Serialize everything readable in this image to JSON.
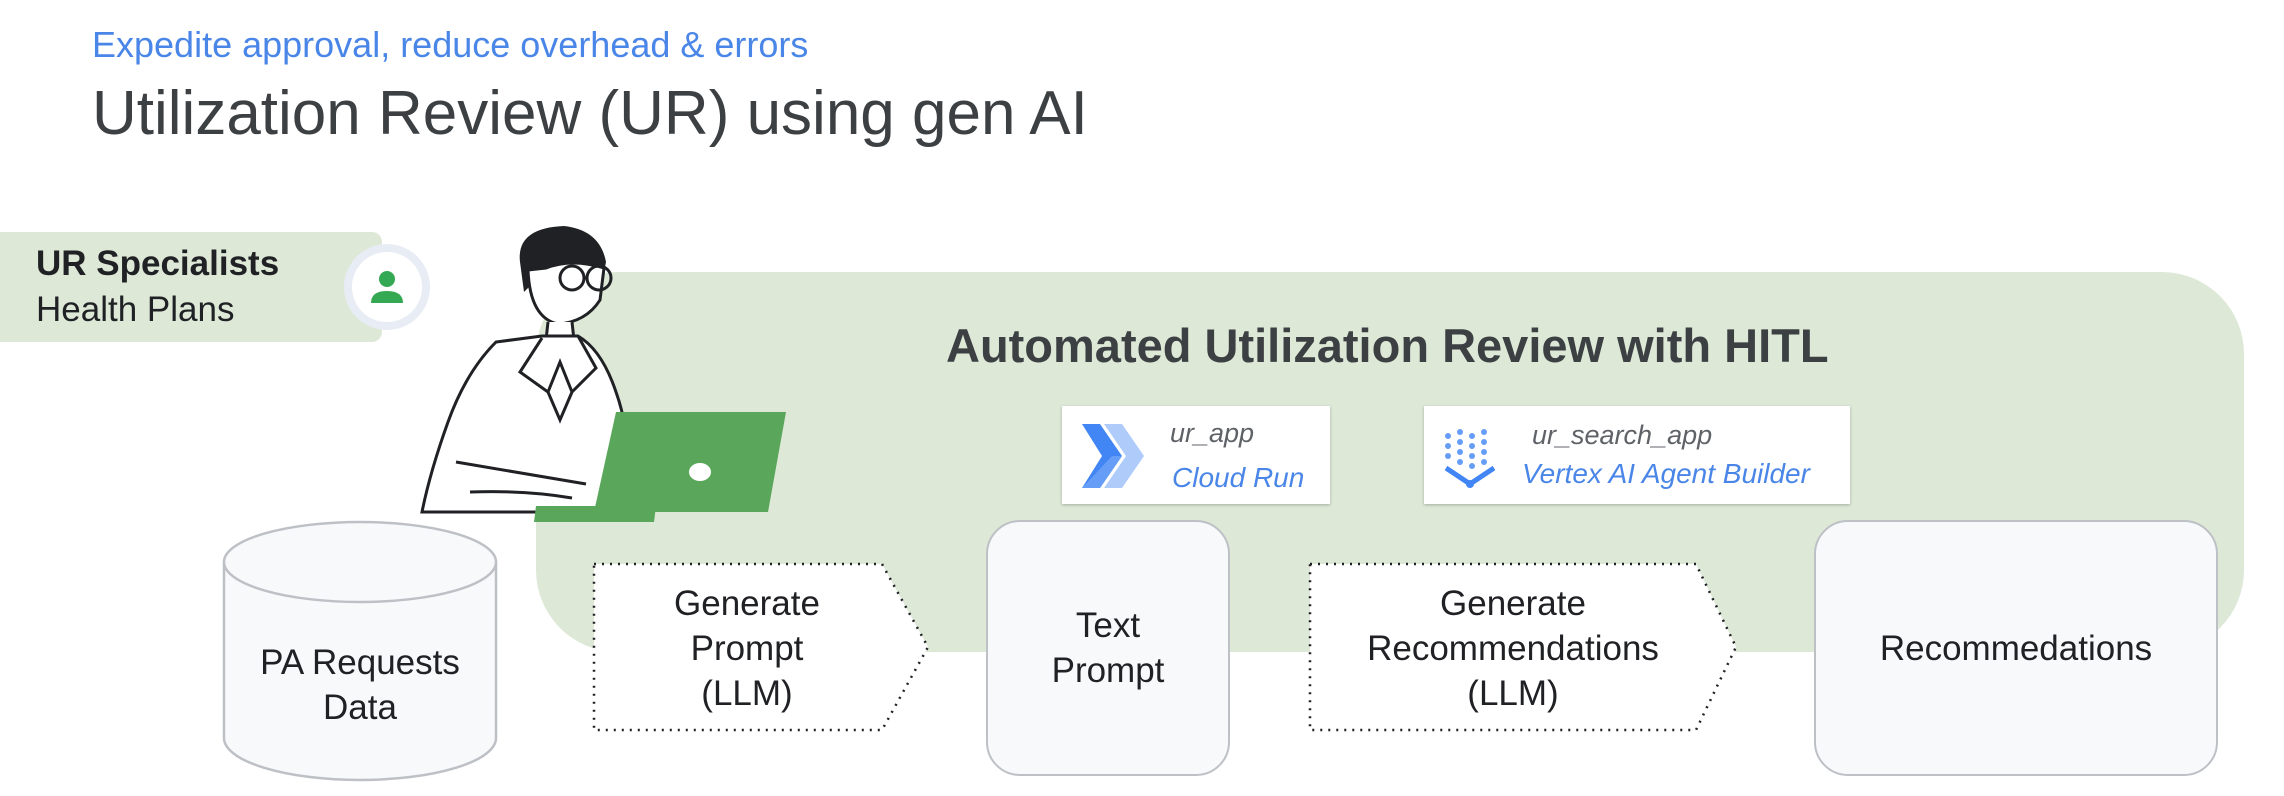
{
  "header": {
    "subtitle": "Expedite approval, reduce overhead & errors",
    "title": "Utilization Review (UR) using gen AI"
  },
  "specialist": {
    "line1": "UR Specialists",
    "line2": "Health Plans"
  },
  "panel": {
    "title": "Automated Utilization Review with HITL"
  },
  "services": [
    {
      "name": "ur_app",
      "product": "Cloud Run",
      "icon": "cloud-run-icon"
    },
    {
      "name": "ur_search_app",
      "product": "Vertex AI Agent Builder",
      "icon": "vertex-ai-agent-builder-icon"
    }
  ],
  "flow": {
    "data_store": {
      "line1": "PA Requests",
      "line2": "Data"
    },
    "step1": {
      "line1": "Generate",
      "line2": "Prompt",
      "line3": "(LLM)"
    },
    "text_prompt": {
      "line1": "Text",
      "line2": "Prompt"
    },
    "step2": {
      "line1": "Generate",
      "line2": "Recommendations",
      "line3": "(LLM)"
    },
    "result": {
      "label": "Recommedations"
    }
  },
  "colors": {
    "accent_blue": "#4a86e8",
    "panel_green": "#dde8d7",
    "laptop_green": "#5aa65a",
    "box_fill": "#f8f9fa",
    "box_border": "#bdc1c6"
  }
}
